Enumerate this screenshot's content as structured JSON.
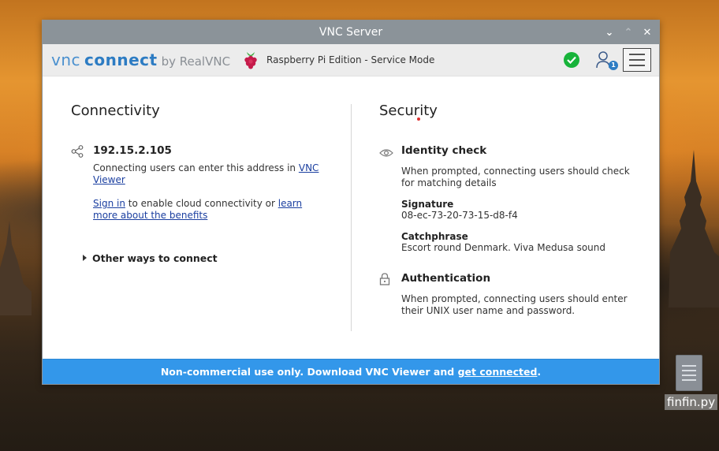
{
  "window": {
    "title": "VNC Server",
    "controls": {
      "minimize": "⌄",
      "maximize": "⌃",
      "close": "✕"
    }
  },
  "toolbar": {
    "logo_vnc": "vnc",
    "logo_connect": "connect",
    "logo_by": "by RealVNC",
    "edition": "Raspberry Pi Edition - Service Mode",
    "user_badge": "1",
    "icons": [
      "raspberry-pi-logo",
      "status-ok-check-icon",
      "user-icon",
      "hamburger-menu-icon"
    ]
  },
  "connectivity": {
    "heading": "Connectivity",
    "address": "192.15.2.105",
    "address_text_pre": "Connecting users can enter this address in ",
    "address_link": "VNC Viewer",
    "signin_link": "Sign in",
    "signin_text_mid": " to enable cloud connectivity or ",
    "learn_more_link": "learn more about the benefits",
    "other_ways": "Other ways to connect"
  },
  "security": {
    "heading": "Security",
    "identity_title": "Identity check",
    "identity_text": "When prompted, connecting users should check for matching details",
    "signature_label": "Signature",
    "signature_value": "08-ec-73-20-73-15-d8-f4",
    "catchphrase_label": "Catchphrase",
    "catchphrase_value": "Escort round Denmark. Viva Medusa sound",
    "auth_title": "Authentication",
    "auth_text": "When prompted, connecting users should enter their UNIX user name and password."
  },
  "banner": {
    "text": "Non-commercial use only. Download VNC Viewer and ",
    "link": "get connected",
    "suffix": "."
  },
  "desktop": {
    "file_label": "finfin.py"
  },
  "colors": {
    "accent": "#3397ea",
    "titlebar": "#8b9399",
    "status_ok": "#17b33a",
    "link": "#1b3fa0"
  }
}
